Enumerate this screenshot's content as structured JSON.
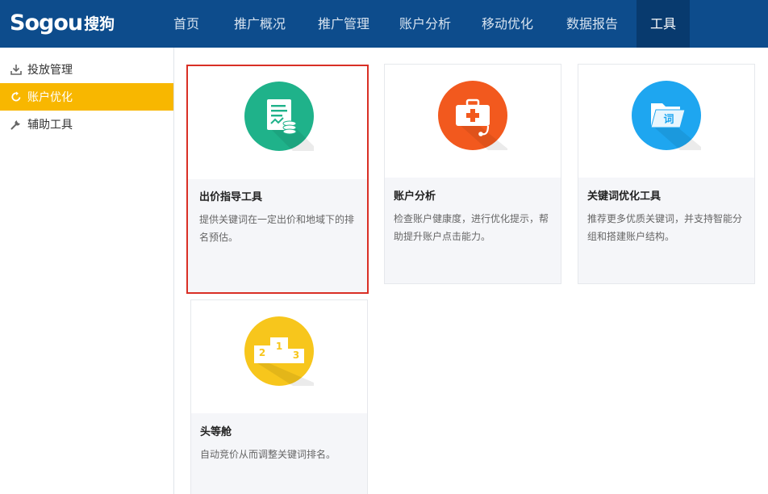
{
  "header": {
    "logo_latin": "Sogou",
    "logo_cn": "搜狗",
    "nav": [
      {
        "label": "首页",
        "active": false
      },
      {
        "label": "推广概况",
        "active": false
      },
      {
        "label": "推广管理",
        "active": false
      },
      {
        "label": "账户分析",
        "active": false
      },
      {
        "label": "移动优化",
        "active": false
      },
      {
        "label": "数据报告",
        "active": false
      },
      {
        "label": "工具",
        "active": true
      }
    ]
  },
  "sidebar": {
    "items": [
      {
        "label": "投放管理",
        "icon": "download-icon",
        "active": false
      },
      {
        "label": "账户优化",
        "icon": "refresh-icon",
        "active": true
      },
      {
        "label": "辅助工具",
        "icon": "wrench-icon",
        "active": false
      }
    ]
  },
  "cards": [
    {
      "title": "出价指导工具",
      "desc": "提供关键词在一定出价和地域下的排名预估。",
      "icon": "document-coins-icon",
      "color": "#1fb28a",
      "selected": true
    },
    {
      "title": "账户分析",
      "desc": "检查账户健康度，进行优化提示，帮助提升账户点击能力。",
      "icon": "medical-kit-icon",
      "color": "#f2591e",
      "selected": false
    },
    {
      "title": "关键词优化工具",
      "desc": "推荐更多优质关键词，并支持智能分组和搭建账户结构。",
      "icon": "folder-word-icon",
      "color": "#1ea6f0",
      "icon_text": "词",
      "selected": false
    },
    {
      "title": "头等舱",
      "desc": "自动竞价从而调整关键词排名。",
      "icon": "podium-icon",
      "color": "#f7c61c",
      "selected": false
    }
  ],
  "podium_numbers": [
    "2",
    "1",
    "3"
  ],
  "colors": {
    "header": "#0d4c8c",
    "nav_active": "#083a6e",
    "sidebar_active": "#f8b700",
    "selected_border": "#d92f25"
  }
}
